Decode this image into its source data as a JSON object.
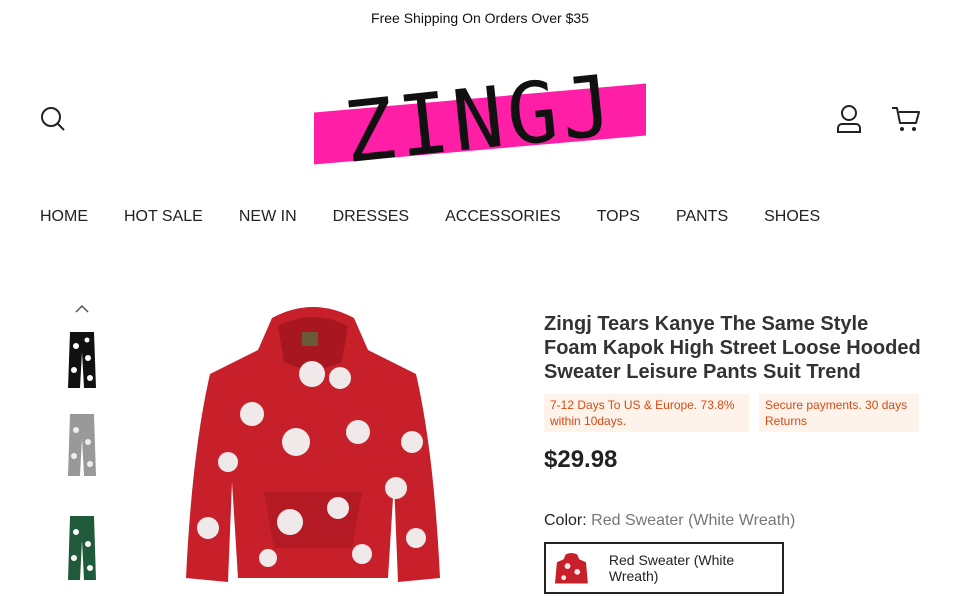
{
  "announcement": "Free Shipping On Orders Over $35",
  "logo": {
    "text": "ZINGJ",
    "band_color": "#ff1fa6"
  },
  "header_icons": {
    "search": "search-icon",
    "account": "user-icon",
    "cart": "cart-icon"
  },
  "nav": [
    "HOME",
    "HOT SALE",
    "NEW IN",
    "DRESSES",
    "ACCESSORIES",
    "TOPS",
    "PANTS",
    "SHOES"
  ],
  "gallery": {
    "scroll_up_icon": "chevron-up-icon",
    "thumbnails": [
      "black pants",
      "grey pants",
      "green pants"
    ]
  },
  "product": {
    "title": "Zingj Tears Kanye The Same Style Foam Kapok High Street Loose Hooded Sweater Leisure Pants Suit Trend",
    "badge_shipping": "7-12 Days To US & Europe. 73.8% within 10days.",
    "badge_payment": "Secure payments. 30 days Returns",
    "price": "$29.98",
    "color_label": "Color:",
    "color_value": "Red Sweater (White Wreath)",
    "swatch_label": "Red Sweater (White Wreath)"
  },
  "colors": {
    "accent_badge_text": "#d84a16",
    "badge_bg": "#fdf3ea",
    "hoodie": "#c8202b"
  }
}
